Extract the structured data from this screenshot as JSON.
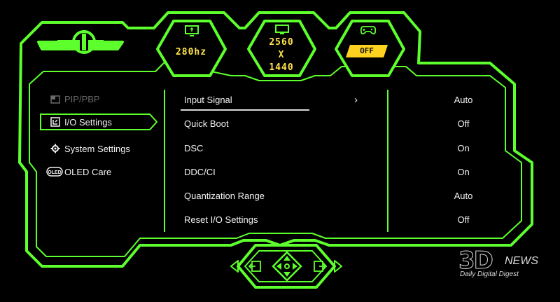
{
  "top_bar": {
    "refresh_rate": "280hz",
    "resolution_width": "2560",
    "resolution_sep": "X",
    "resolution_height": "1440",
    "game_mode_status": "OFF"
  },
  "sidebar": {
    "items": [
      {
        "label": "PIP/PBP",
        "icon": "pip-icon",
        "state": "disabled"
      },
      {
        "label": "I/O Settings",
        "icon": "io-icon",
        "state": "selected"
      },
      {
        "label": "System Settings",
        "icon": "gear-icon",
        "state": "normal"
      },
      {
        "label": "OLED Care",
        "icon": "oled-icon",
        "state": "normal"
      }
    ]
  },
  "menu": {
    "rows": [
      {
        "label": "Input Signal",
        "value": "Auto",
        "has_submenu": true
      },
      {
        "label": "Quick Boot",
        "value": "Off"
      },
      {
        "label": "DSC",
        "value": "On"
      },
      {
        "label": "DDC/CI",
        "value": "On"
      },
      {
        "label": "Quantization Range",
        "value": "Auto"
      },
      {
        "label": "Reset I/O Settings",
        "value": "Off"
      }
    ],
    "submenu_glyph": "›"
  },
  "watermark": {
    "logo": "3D",
    "news": "NEWS",
    "tagline": "Daily Digital Digest"
  },
  "colors": {
    "accent": "#5dff2c",
    "highlight": "#ffe34d",
    "badge": "#ffd21f"
  }
}
